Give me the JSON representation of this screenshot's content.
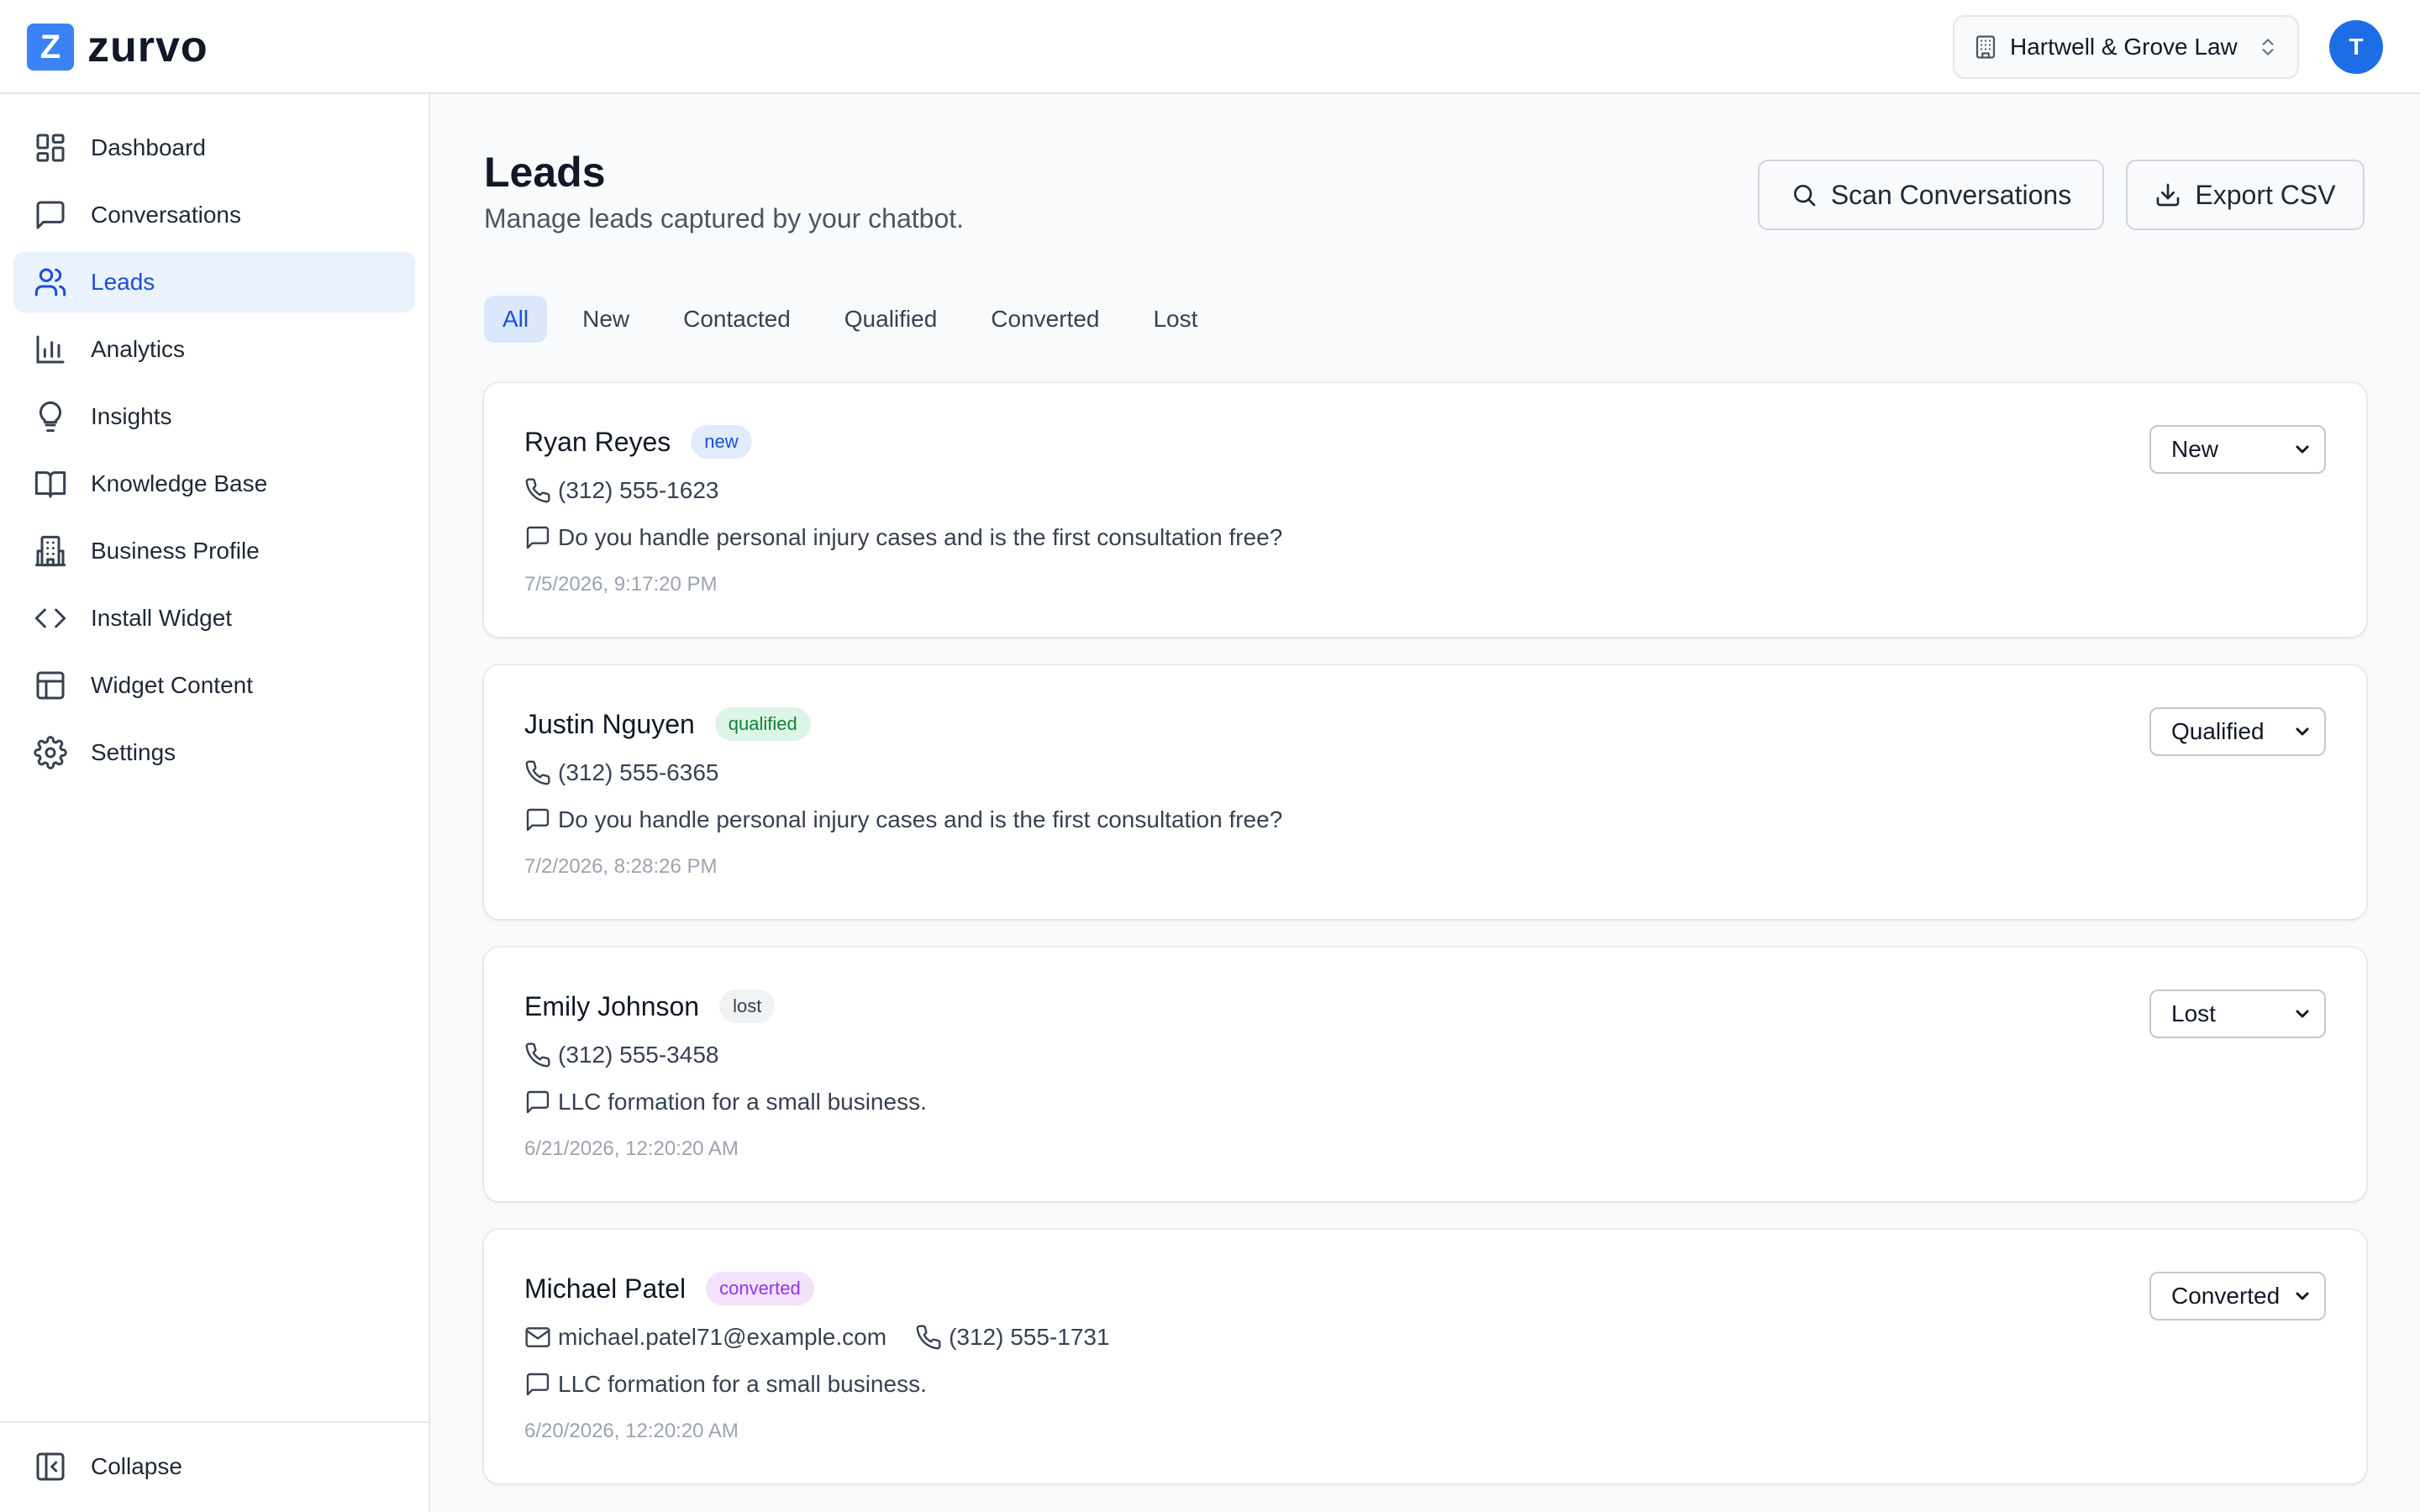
{
  "app": {
    "name": "zurvo",
    "logo_letter": "Z"
  },
  "header": {
    "org_name": "Hartwell & Grove Law",
    "avatar_initial": "T"
  },
  "sidebar": {
    "items": [
      {
        "label": "Dashboard",
        "icon": "dashboard-icon"
      },
      {
        "label": "Conversations",
        "icon": "message-icon"
      },
      {
        "label": "Leads",
        "icon": "users-icon",
        "active": true
      },
      {
        "label": "Analytics",
        "icon": "bar-chart-icon"
      },
      {
        "label": "Insights",
        "icon": "lightbulb-icon"
      },
      {
        "label": "Knowledge Base",
        "icon": "book-icon"
      },
      {
        "label": "Business Profile",
        "icon": "building-icon"
      },
      {
        "label": "Install Widget",
        "icon": "code-icon"
      },
      {
        "label": "Widget Content",
        "icon": "layout-icon"
      },
      {
        "label": "Settings",
        "icon": "gear-icon"
      }
    ],
    "collapse_label": "Collapse"
  },
  "page": {
    "title": "Leads",
    "subtitle": "Manage leads captured by your chatbot.",
    "scan_button": "Scan Conversations",
    "export_button": "Export CSV"
  },
  "filters": [
    "All",
    "New",
    "Contacted",
    "Qualified",
    "Converted",
    "Lost"
  ],
  "active_filter": "All",
  "leads": [
    {
      "name": "Ryan Reyes",
      "status_badge": "new",
      "email": "",
      "phone": "(312) 555-1623",
      "message": "Do you handle personal injury cases and is the first consultation free?",
      "date": "7/5/2026, 9:17:20 PM",
      "status_select": "New"
    },
    {
      "name": "Justin Nguyen",
      "status_badge": "qualified",
      "email": "",
      "phone": "(312) 555-6365",
      "message": "Do you handle personal injury cases and is the first consultation free?",
      "date": "7/2/2026, 8:28:26 PM",
      "status_select": "Qualified"
    },
    {
      "name": "Emily Johnson",
      "status_badge": "lost",
      "email": "",
      "phone": "(312) 555-3458",
      "message": "LLC formation for a small business.",
      "date": "6/21/2026, 12:20:20 AM",
      "status_select": "Lost"
    },
    {
      "name": "Michael Patel",
      "status_badge": "converted",
      "email": "michael.patel71@example.com",
      "phone": "(312) 555-1731",
      "message": "LLC formation for a small business.",
      "date": "6/20/2026, 12:20:20 AM",
      "status_select": "Converted"
    }
  ],
  "colors": {
    "brand": "#3b82f6",
    "active_nav_bg": "#eaf2fd",
    "active_text": "#1d4ed8",
    "badge_new": "#1d4ed8",
    "badge_qualified": "#15803d",
    "badge_lost": "#374151",
    "badge_converted": "#9333ea"
  }
}
